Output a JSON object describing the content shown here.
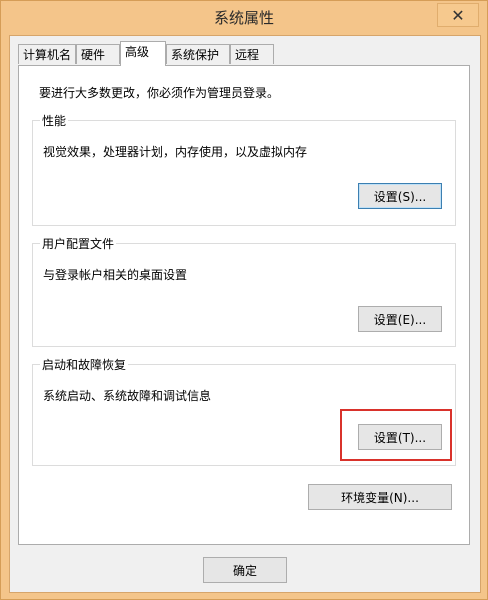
{
  "window": {
    "title": "系统属性",
    "close_symbol": "✕"
  },
  "tabs": [
    {
      "label": "计算机名"
    },
    {
      "label": "硬件"
    },
    {
      "label": "高级"
    },
    {
      "label": "系统保护"
    },
    {
      "label": "远程"
    }
  ],
  "active_tab": "高级",
  "intro_text": "要进行大多数更改，你必须作为管理员登录。",
  "groups": {
    "performance": {
      "title": "性能",
      "description": "视觉效果，处理器计划，内存使用，以及虚拟内存",
      "button": "设置(S)..."
    },
    "user_profiles": {
      "title": "用户配置文件",
      "description": "与登录帐户相关的桌面设置",
      "button": "设置(E)..."
    },
    "startup_recovery": {
      "title": "启动和故障恢复",
      "description": "系统启动、系统故障和调试信息",
      "button": "设置(T)..."
    }
  },
  "env_button": "环境变量(N)...",
  "ok_button": "确定",
  "highlight_color": "#d9322b"
}
